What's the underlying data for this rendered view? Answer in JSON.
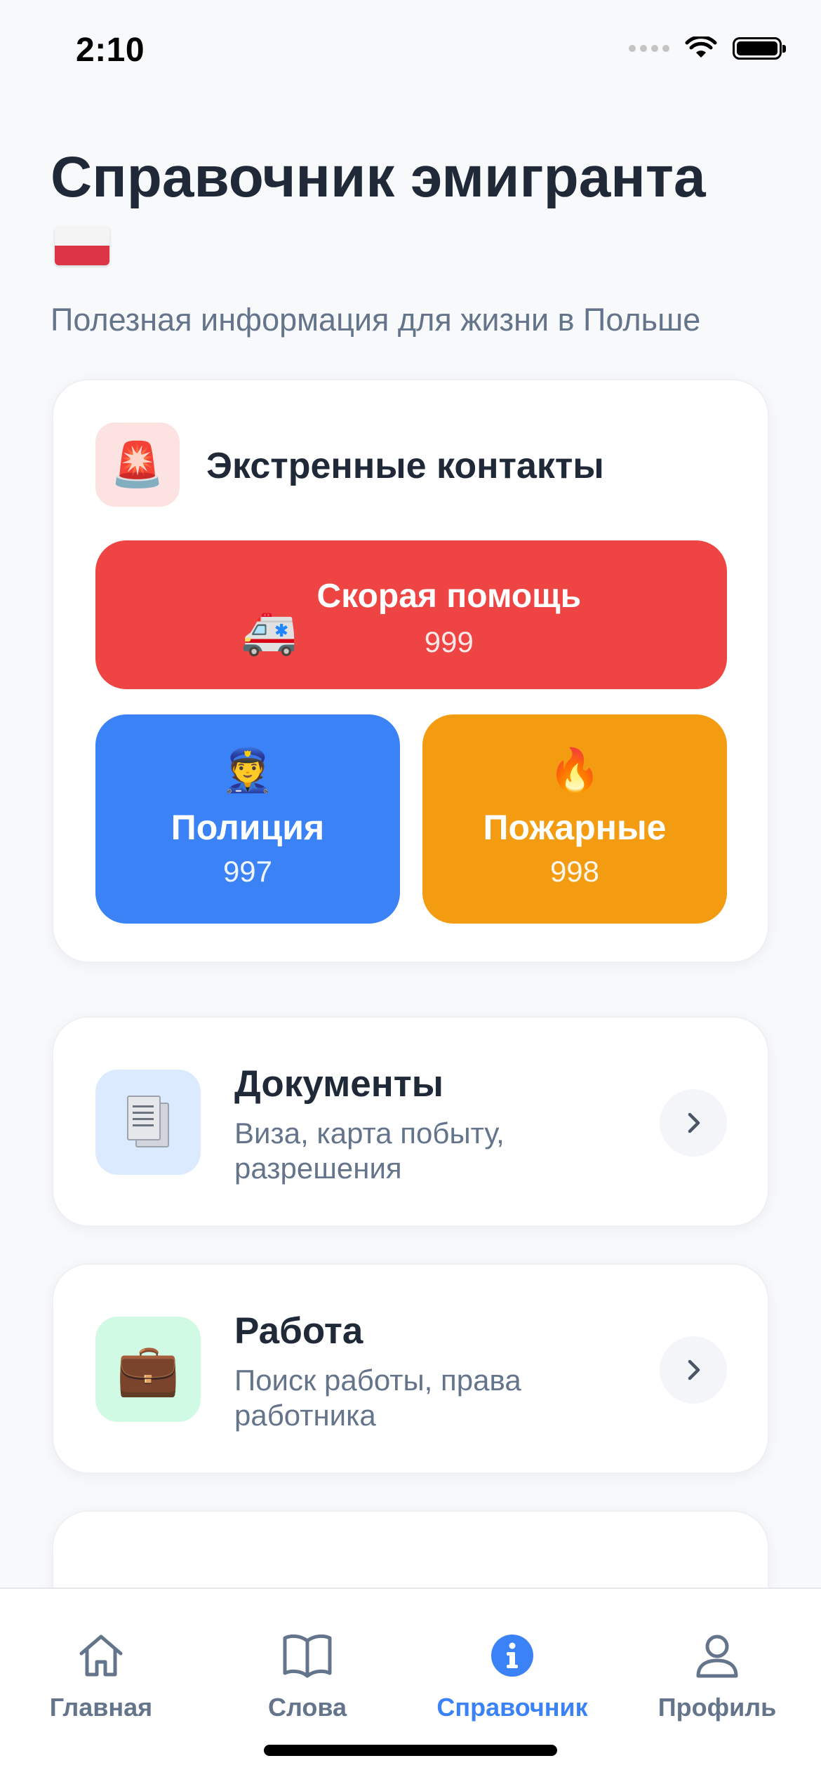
{
  "status_bar": {
    "time": "2:10"
  },
  "header": {
    "title": "Справочник эмигранта",
    "subtitle": "Полезная информация для жизни в Польше"
  },
  "emergency": {
    "icon": "🚨",
    "title": "Экстренные контакты",
    "ambulance": {
      "icon": "🚑",
      "label": "Скорая помощь",
      "number": "999"
    },
    "police": {
      "icon": "👮",
      "label": "Полиция",
      "number": "997"
    },
    "fire": {
      "icon": "🔥",
      "label": "Пожарные",
      "number": "998"
    }
  },
  "sections": [
    {
      "title": "Документы",
      "description": "Виза, карта побыту, разрешения",
      "icon": "document-icon",
      "icon_bg": "#dbeafe"
    },
    {
      "title": "Работа",
      "description": "Поиск работы, права работника",
      "icon": "💼",
      "icon_bg": "#d1fae5"
    }
  ],
  "tab_bar": {
    "items": [
      {
        "label": "Главная",
        "icon": "home-icon",
        "active": false
      },
      {
        "label": "Слова",
        "icon": "book-icon",
        "active": false
      },
      {
        "label": "Справочник",
        "icon": "info-icon",
        "active": true
      },
      {
        "label": "Профиль",
        "icon": "profile-icon",
        "active": false
      }
    ]
  },
  "colors": {
    "ambulance": "#ef4444",
    "police": "#3b82f6",
    "fire": "#f39c12",
    "accent": "#3b82f6"
  }
}
